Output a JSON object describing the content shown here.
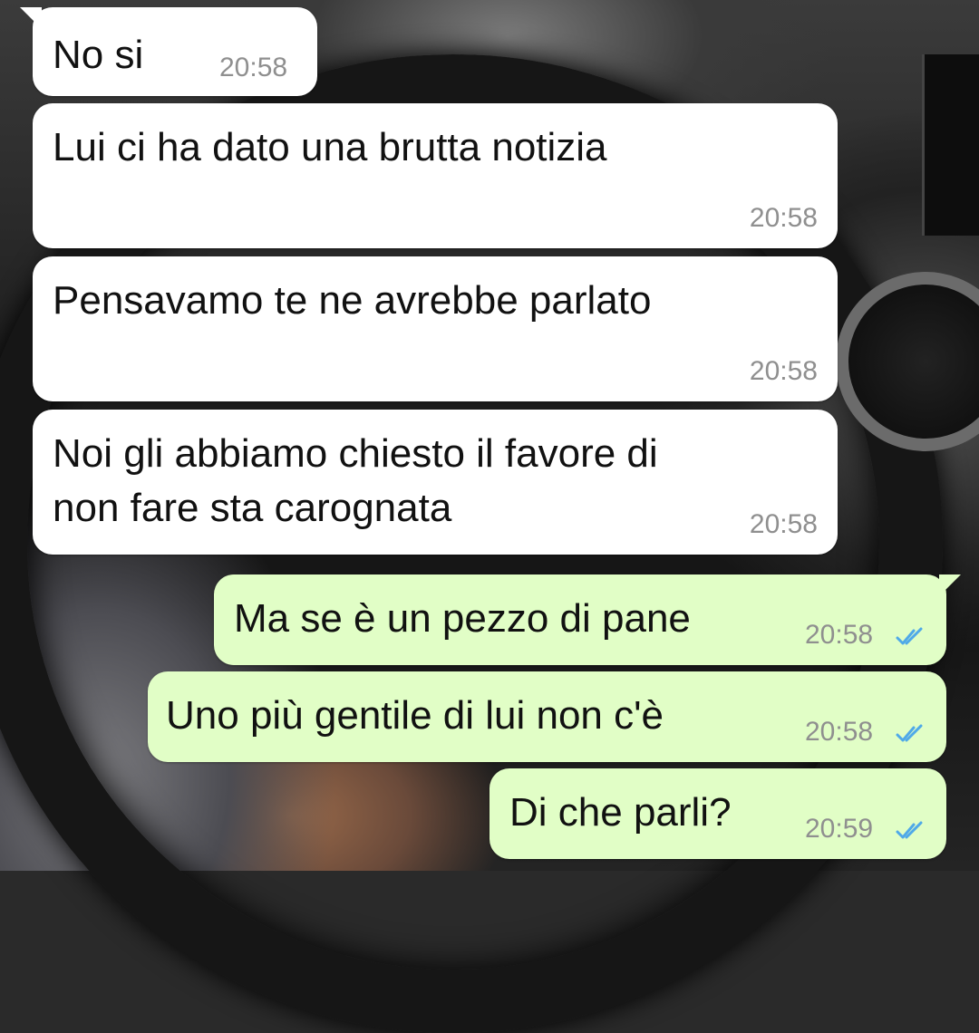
{
  "messages": [
    {
      "direction": "incoming",
      "text": "No si",
      "time": "20:58"
    },
    {
      "direction": "incoming",
      "text": "Lui ci ha dato una brutta notizia",
      "time": "20:58"
    },
    {
      "direction": "incoming",
      "text": "Pensavamo te ne avrebbe parlato",
      "time": "20:58"
    },
    {
      "direction": "incoming",
      "text_line1": "Noi gli abbiamo chiesto il favore di",
      "text_line2": "non fare sta carognata",
      "time": "20:58"
    },
    {
      "direction": "outgoing",
      "text": "Ma se è un pezzo di pane",
      "time": "20:58",
      "status": "read"
    },
    {
      "direction": "outgoing",
      "text": "Uno più gentile di lui non c'è",
      "time": "20:58",
      "status": "read"
    },
    {
      "direction": "outgoing",
      "text": "Di che parli?",
      "time": "20:59",
      "status": "read"
    }
  ],
  "colors": {
    "incoming_bubble": "#ffffff",
    "outgoing_bubble": "#e1fec6",
    "read_ticks": "#4fa9e8",
    "timestamp": "#8f8f8f"
  },
  "icons": {
    "read_receipt": "double-check-icon"
  }
}
